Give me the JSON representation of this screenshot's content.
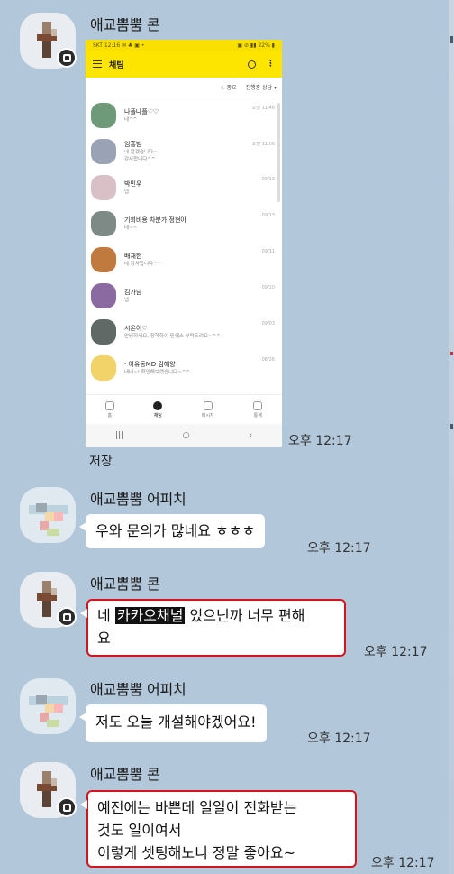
{
  "messages": [
    {
      "sender": "애교뿜뿜 콘",
      "time": "오후 12:17",
      "save_label": "저장"
    },
    {
      "sender": "애교뿜뿜 어피치",
      "text": "우와 문의가 많네요 ㅎㅎㅎ",
      "time": "오후 12:17"
    },
    {
      "sender": "애교뿜뿜 콘",
      "text_pre": "네 ",
      "text_hl": "카카오채널",
      "text_post": " 있으닌까 너무 편해",
      "text_line2": "요",
      "time": "오후 12:17"
    },
    {
      "sender": "애교뿜뿜 어피치",
      "text": "저도 오늘 개설해야겠어요!",
      "time": "오후 12:17"
    },
    {
      "sender": "애교뿜뿜 콘",
      "line1": "예전에는 바쁜데 일일이 전화받는",
      "line2": "것도 일이여서",
      "line3": "이렇게 셋팅해노니 정말 좋아요~",
      "time": "오후 12:17"
    }
  ],
  "phone": {
    "status_left": "SKT 12:16 ✉ ♣ ▣ •",
    "status_right": "▣ ⊘ ▮▮ 22% ▮",
    "title": "채팅",
    "filter_star": "☆ 중요",
    "filter_status": "진행중 상담 ▾",
    "chats": [
      {
        "name": "나플나플♡♡",
        "preview": "네^^",
        "date": "오전 11:46",
        "color": "#6f9a7a"
      },
      {
        "name": "임흥범",
        "preview": "네 알겠습니다~\n감사합니다^^",
        "date": "오전 11:06",
        "color": "#9aa2b6"
      },
      {
        "name": "박민우",
        "preview": "넵",
        "date": "09/13",
        "color": "#d8c0c6"
      },
      {
        "name": "기회비용 차분가 정현아",
        "preview": "네~~",
        "date": "09/13",
        "color": "#7d8a86"
      },
      {
        "name": "배재헌",
        "preview": "네 감사합니다^^",
        "date": "09/11",
        "color": "#c07a3e"
      },
      {
        "name": "김가님",
        "preview": "넵",
        "date": "09/10",
        "color": "#8a6aa0"
      },
      {
        "name": "시온이♡",
        "preview": "안녕하세요, 장학하이 민혜스 부탁드려요~^^",
        "date": "09/03",
        "color": "#5f6a66"
      },
      {
        "name": "· 이유동MD 김해양",
        "preview": "네네~! 확인해보겠습니다~^^",
        "date": "08/26",
        "color": "#f1d36a"
      }
    ],
    "tabs": [
      {
        "label": "홈",
        "active": false
      },
      {
        "label": "채팅",
        "active": true
      },
      {
        "label": "메시지",
        "active": false
      },
      {
        "label": "통계",
        "active": false
      }
    ],
    "nav": [
      "|||",
      "○",
      "‹"
    ]
  }
}
